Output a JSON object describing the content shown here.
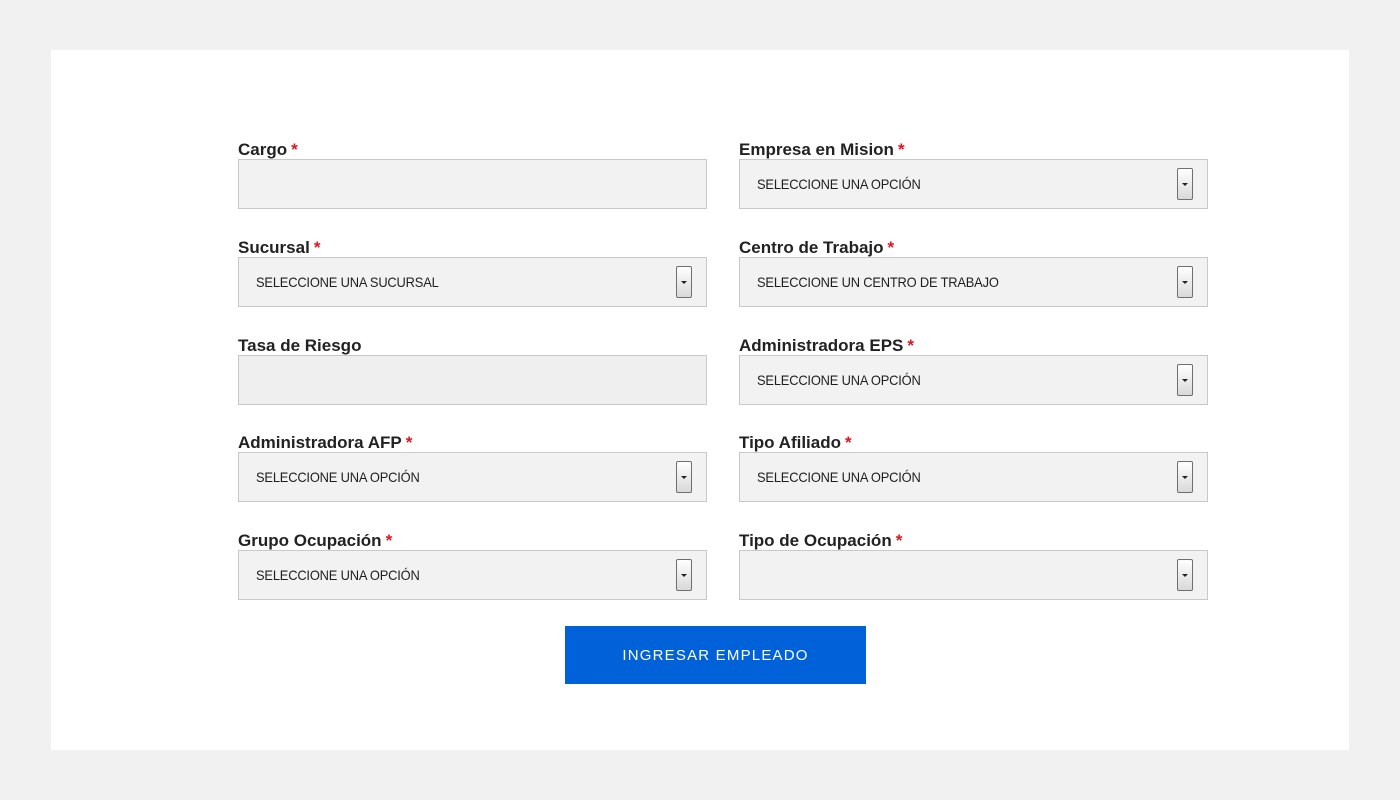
{
  "form": {
    "fields": [
      {
        "label": "Cargo",
        "required": "*",
        "type": "text",
        "value": ""
      },
      {
        "label": "Empresa en Mision",
        "required": "*",
        "type": "select",
        "value": "SELECCIONE UNA OPCIÓN"
      },
      {
        "label": "Sucursal",
        "required": "*",
        "type": "select",
        "value": "SELECCIONE UNA SUCURSAL"
      },
      {
        "label": "Centro de Trabajo",
        "required": "*",
        "type": "select",
        "value": "SELECCIONE UN CENTRO DE TRABAJO"
      },
      {
        "label": "Tasa de Riesgo",
        "type": "text",
        "value": ""
      },
      {
        "label": "Administradora EPS",
        "required": "*",
        "type": "select",
        "value": "SELECCIONE UNA OPCIÓN"
      },
      {
        "label": "Administradora AFP",
        "required": "*",
        "type": "select",
        "value": "SELECCIONE UNA OPCIÓN"
      },
      {
        "label": "Tipo Afiliado",
        "required": "*",
        "type": "select",
        "value": "SELECCIONE UNA OPCIÓN"
      },
      {
        "label": "Grupo Ocupación",
        "required": "*",
        "type": "select",
        "value": "SELECCIONE UNA OPCIÓN"
      },
      {
        "label": "Tipo de Ocupación",
        "required": "*",
        "type": "select",
        "value": ""
      }
    ],
    "submit_label": "INGRESAR EMPLEADO"
  },
  "colors": {
    "background": "#f1f1f1",
    "card": "#ffffff",
    "required": "#e0141e",
    "button": "#0061d9"
  },
  "icons": {
    "select_arrow": "chevron-down-icon"
  }
}
